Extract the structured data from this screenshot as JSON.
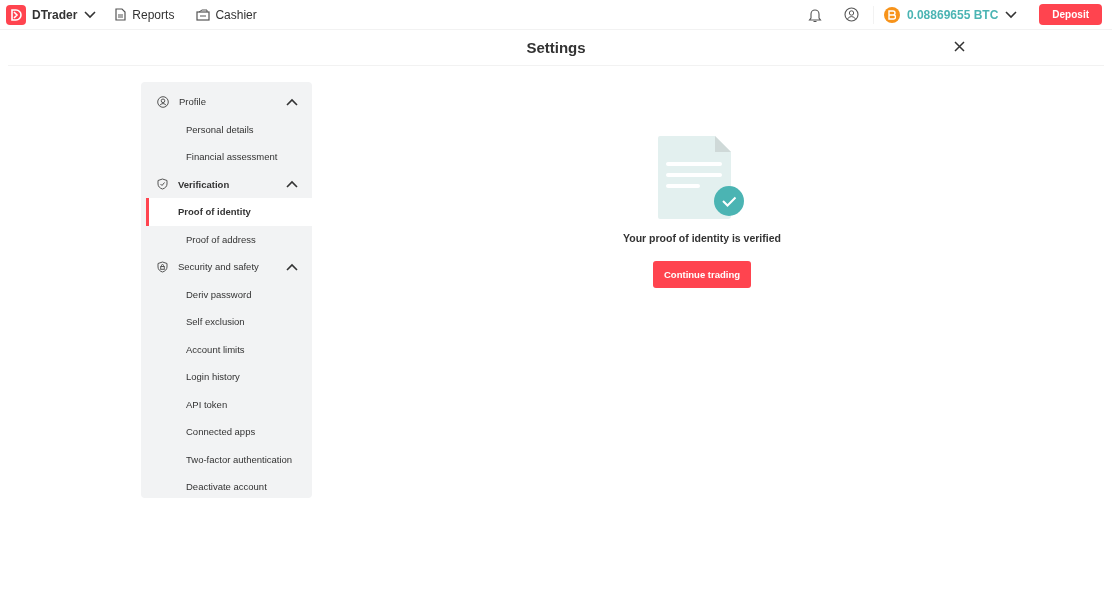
{
  "header": {
    "app_name": "DTrader",
    "nav": [
      {
        "label": "Reports",
        "kind": "reports"
      },
      {
        "label": "Cashier",
        "kind": "cashier"
      }
    ],
    "balance": "0.08869655 BTC",
    "deposit": "Deposit"
  },
  "settings": {
    "title": "Settings"
  },
  "sidebar": {
    "sections": [
      {
        "label": "Profile",
        "kind": "profile",
        "expanded": true,
        "items": [
          {
            "label": "Personal details",
            "selected": false
          },
          {
            "label": "Financial assessment",
            "selected": false
          }
        ]
      },
      {
        "label": "Verification",
        "kind": "verification",
        "expanded": true,
        "items": [
          {
            "label": "Proof of identity",
            "selected": true
          },
          {
            "label": "Proof of address",
            "selected": false
          }
        ]
      },
      {
        "label": "Security and safety",
        "kind": "security",
        "expanded": true,
        "items": [
          {
            "label": "Deriv password",
            "selected": false
          },
          {
            "label": "Self exclusion",
            "selected": false
          },
          {
            "label": "Account limits",
            "selected": false
          },
          {
            "label": "Login history",
            "selected": false
          },
          {
            "label": "API token",
            "selected": false
          },
          {
            "label": "Connected apps",
            "selected": false
          },
          {
            "label": "Two-factor authentication",
            "selected": false
          },
          {
            "label": "Deactivate account",
            "selected": false
          }
        ]
      }
    ]
  },
  "content": {
    "message": "Your proof of identity is verified",
    "button": "Continue trading"
  }
}
